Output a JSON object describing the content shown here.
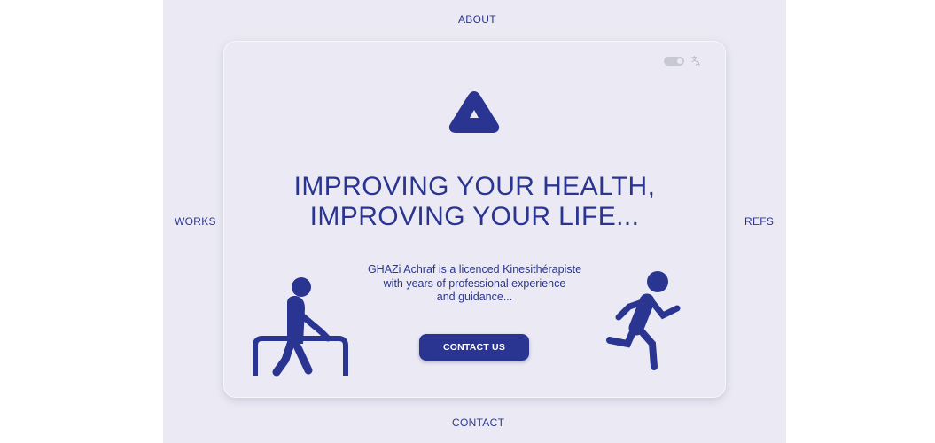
{
  "nav": {
    "about": "ABOUT",
    "works": "WORKS",
    "refs": "REFS",
    "contact": "CONTACT"
  },
  "hero": {
    "headline_line1": "IMPROVING YOUR HEALTH,",
    "headline_line2": "IMPROVING YOUR LIFE...",
    "desc_line1": "GHAZi Achraf is a licenced Kinesithérapiste",
    "desc_line2": "with years of professional experience",
    "desc_line3": "and guidance...",
    "cta_label": "CONTACT US"
  },
  "colors": {
    "accent": "#2a3591",
    "background": "#ebeaf4"
  },
  "icons": {
    "logo": "triangle-logo-icon",
    "theme_toggle": "toggle-switch",
    "language": "translate-icon",
    "left_illustration": "rehab-parallel-bars-figure",
    "right_illustration": "running-figure"
  }
}
